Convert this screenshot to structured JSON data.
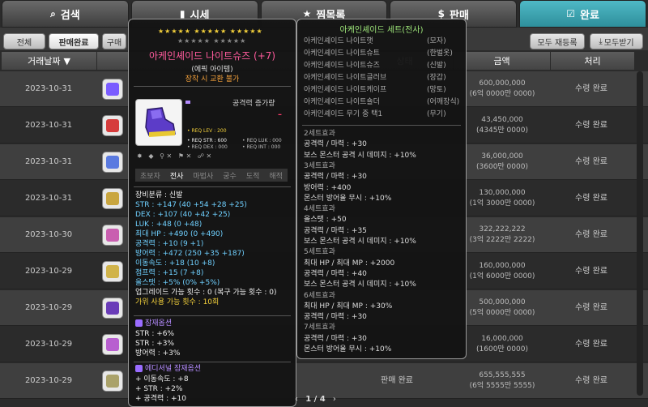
{
  "tabs": [
    {
      "label": "검색",
      "icon": "search-icon",
      "glyph": "⌕"
    },
    {
      "label": "시세",
      "icon": "chart-icon",
      "glyph": "▮"
    },
    {
      "label": "찜목록",
      "icon": "star-icon",
      "glyph": "★"
    },
    {
      "label": "판매",
      "icon": "coin-icon",
      "glyph": "$"
    },
    {
      "label": "완료",
      "icon": "check-icon",
      "glyph": "☑"
    }
  ],
  "filters": {
    "all": "전체",
    "sold": "판매완료",
    "bought": "구매"
  },
  "actions": {
    "reregister_all": "모두 재등록",
    "receive_all": "모두받기"
  },
  "columns": {
    "date": "거래날짜",
    "status": "상태",
    "price": "금액",
    "process": "처리"
  },
  "rows": [
    {
      "date": "2023-10-31",
      "price": "600,000,000",
      "price_sub": "(6억 0000만 0000)",
      "state": "수령 완료",
      "color": "#7a5cff"
    },
    {
      "date": "2023-10-31",
      "price": "43,450,000",
      "price_sub": "(4345만 0000)",
      "state": "수령 완료",
      "color": "#d63c3c"
    },
    {
      "date": "2023-10-31",
      "price": "36,000,000",
      "price_sub": "(3600만 0000)",
      "state": "수령 완료",
      "color": "#5a7ae0"
    },
    {
      "date": "2023-10-31",
      "price": "130,000,000",
      "price_sub": "(1억 3000만 0000)",
      "state": "수령 완료",
      "color": "#c9a640"
    },
    {
      "date": "2023-10-30",
      "price": "322,222,222",
      "price_sub": "(3억 2222만 2222)",
      "state": "수령 완료",
      "color": "#c95fb0"
    },
    {
      "date": "2023-10-29",
      "price": "160,000,000",
      "price_sub": "(1억 6000만 0000)",
      "state": "수령 완료",
      "color": "#d0b34a"
    },
    {
      "date": "2023-10-29",
      "price": "500,000,000",
      "price_sub": "(5억 0000만 0000)",
      "state": "수령 완료",
      "color": "#6a3cb8"
    },
    {
      "date": "2023-10-29",
      "price": "16,000,000",
      "price_sub": "(1600만 0000)",
      "state": "수령 완료",
      "color": "#b85fd0"
    },
    {
      "date": "2023-10-29",
      "price": "655,555,555",
      "price_sub": "(6억 5555만 5555)",
      "state": "수령 완료",
      "mid": "판매 완료",
      "color": "#aaa26a"
    }
  ],
  "tooltip": {
    "stars_row1": "★★★★★ ★★★★★ ★★★★★",
    "stars_row2": "★★★★★ ★★★★★",
    "name": "아케인셰이드 나이트슈즈 (+7)",
    "rarity": "(에픽 아이템)",
    "trade": "장착 시 교환 불가",
    "atk_increase": "공격력 증가량",
    "atk_value": "–",
    "req_lev": "• REQ LEV : 200",
    "req_str": "• REQ STR : 600",
    "req_luk": "• REQ LUK : 000",
    "req_dex": "• REQ DEX : 000",
    "req_int": "• REQ INT : 000",
    "jobs": [
      "초보자",
      "전사",
      "마법사",
      "궁수",
      "도적",
      "해적"
    ],
    "category": "장비분류 : 신발",
    "stats": [
      {
        "t": "STR : +147 (40 +54 +28 +25)",
        "c": "blue"
      },
      {
        "t": "DEX : +107 (40 +42 +25)",
        "c": "blue"
      },
      {
        "t": "LUK : +48 (0 +48)",
        "c": "blue"
      },
      {
        "t": "최대 HP : +490 (0 +490)",
        "c": "blue"
      },
      {
        "t": "공격력 : +10 (9 +1)",
        "c": "blue"
      },
      {
        "t": "방어력 : +472 (250 +35 +187)",
        "c": "blue"
      },
      {
        "t": "이동속도 : +18 (10 +8)",
        "c": "blue"
      },
      {
        "t": "점프력 : +15 (7 +8)",
        "c": "blue"
      },
      {
        "t": "올스탯 : +5% (0% +5%)",
        "c": "blue"
      },
      {
        "t": "업그레이드 가능 횟수 : 0 (복구 가능 횟수 : 0)",
        "c": "white"
      },
      {
        "t": "가위 사용 가능 횟수 : 10회",
        "c": "yel"
      }
    ],
    "potential_title": "잠재옵션",
    "potential": [
      "STR : +6%",
      "STR : +3%",
      "방어력 : +3%"
    ],
    "additional_title": "에디셔널 잠재옵션",
    "additional": [
      "+ 이동속도 : +8",
      "+ STR : +2%",
      "+ 공격력 : +10"
    ]
  },
  "set_tooltip": {
    "title": "아케인셰이드 세트(전사)",
    "items": [
      {
        "n": "아케인셰이드 나이트햇",
        "s": "(모자)"
      },
      {
        "n": "아케인셰이드 나이트슈트",
        "s": "(한벌옷)"
      },
      {
        "n": "아케인셰이드 나이트슈즈",
        "s": "(신발)"
      },
      {
        "n": "아케인셰이드 나이트글러브",
        "s": "(장갑)"
      },
      {
        "n": "아케인셰이드 나이트케이프",
        "s": "(망토)"
      },
      {
        "n": "아케인셰이드 나이트숄더",
        "s": "(어깨장식)"
      },
      {
        "n": "아케인셰이드 무기 중 택1",
        "s": "(무기)"
      }
    ],
    "effects": [
      {
        "t": "2세트효과",
        "c": "yel"
      },
      {
        "t": "공격력 / 마력 : +30",
        "c": "w"
      },
      {
        "t": "보스 몬스터 공격 시 데미지 : +10%",
        "c": "w"
      },
      {
        "t": "3세트효과",
        "c": "yel"
      },
      {
        "t": "공격력 / 마력 : +30",
        "c": "w"
      },
      {
        "t": "방어력 : +400",
        "c": "w"
      },
      {
        "t": "몬스터 방어율 무시 : +10%",
        "c": "w"
      },
      {
        "t": "4세트효과",
        "c": "yel"
      },
      {
        "t": "올스탯 : +50",
        "c": "w"
      },
      {
        "t": "공격력 / 마력 : +35",
        "c": "w"
      },
      {
        "t": "보스 몬스터 공격 시 데미지 : +10%",
        "c": "w"
      },
      {
        "t": "5세트효과",
        "c": "yel"
      },
      {
        "t": "최대 HP / 최대 MP : +2000",
        "c": "w"
      },
      {
        "t": "공격력 / 마력 : +40",
        "c": "w"
      },
      {
        "t": "보스 몬스터 공격 시 데미지 : +10%",
        "c": "w"
      },
      {
        "t": "6세트효과",
        "c": "yel"
      },
      {
        "t": "최대 HP / 최대 MP : +30%",
        "c": "w"
      },
      {
        "t": "공격력 / 마력 : +30",
        "c": "w"
      },
      {
        "t": "7세트효과",
        "c": "yel"
      },
      {
        "t": "공격력 / 마력 : +30",
        "c": "w"
      },
      {
        "t": "몬스터 방어율 무시 : +10%",
        "c": "w"
      }
    ]
  },
  "pager": {
    "text": "1 / 4",
    "prev": "‹",
    "next": "›"
  }
}
